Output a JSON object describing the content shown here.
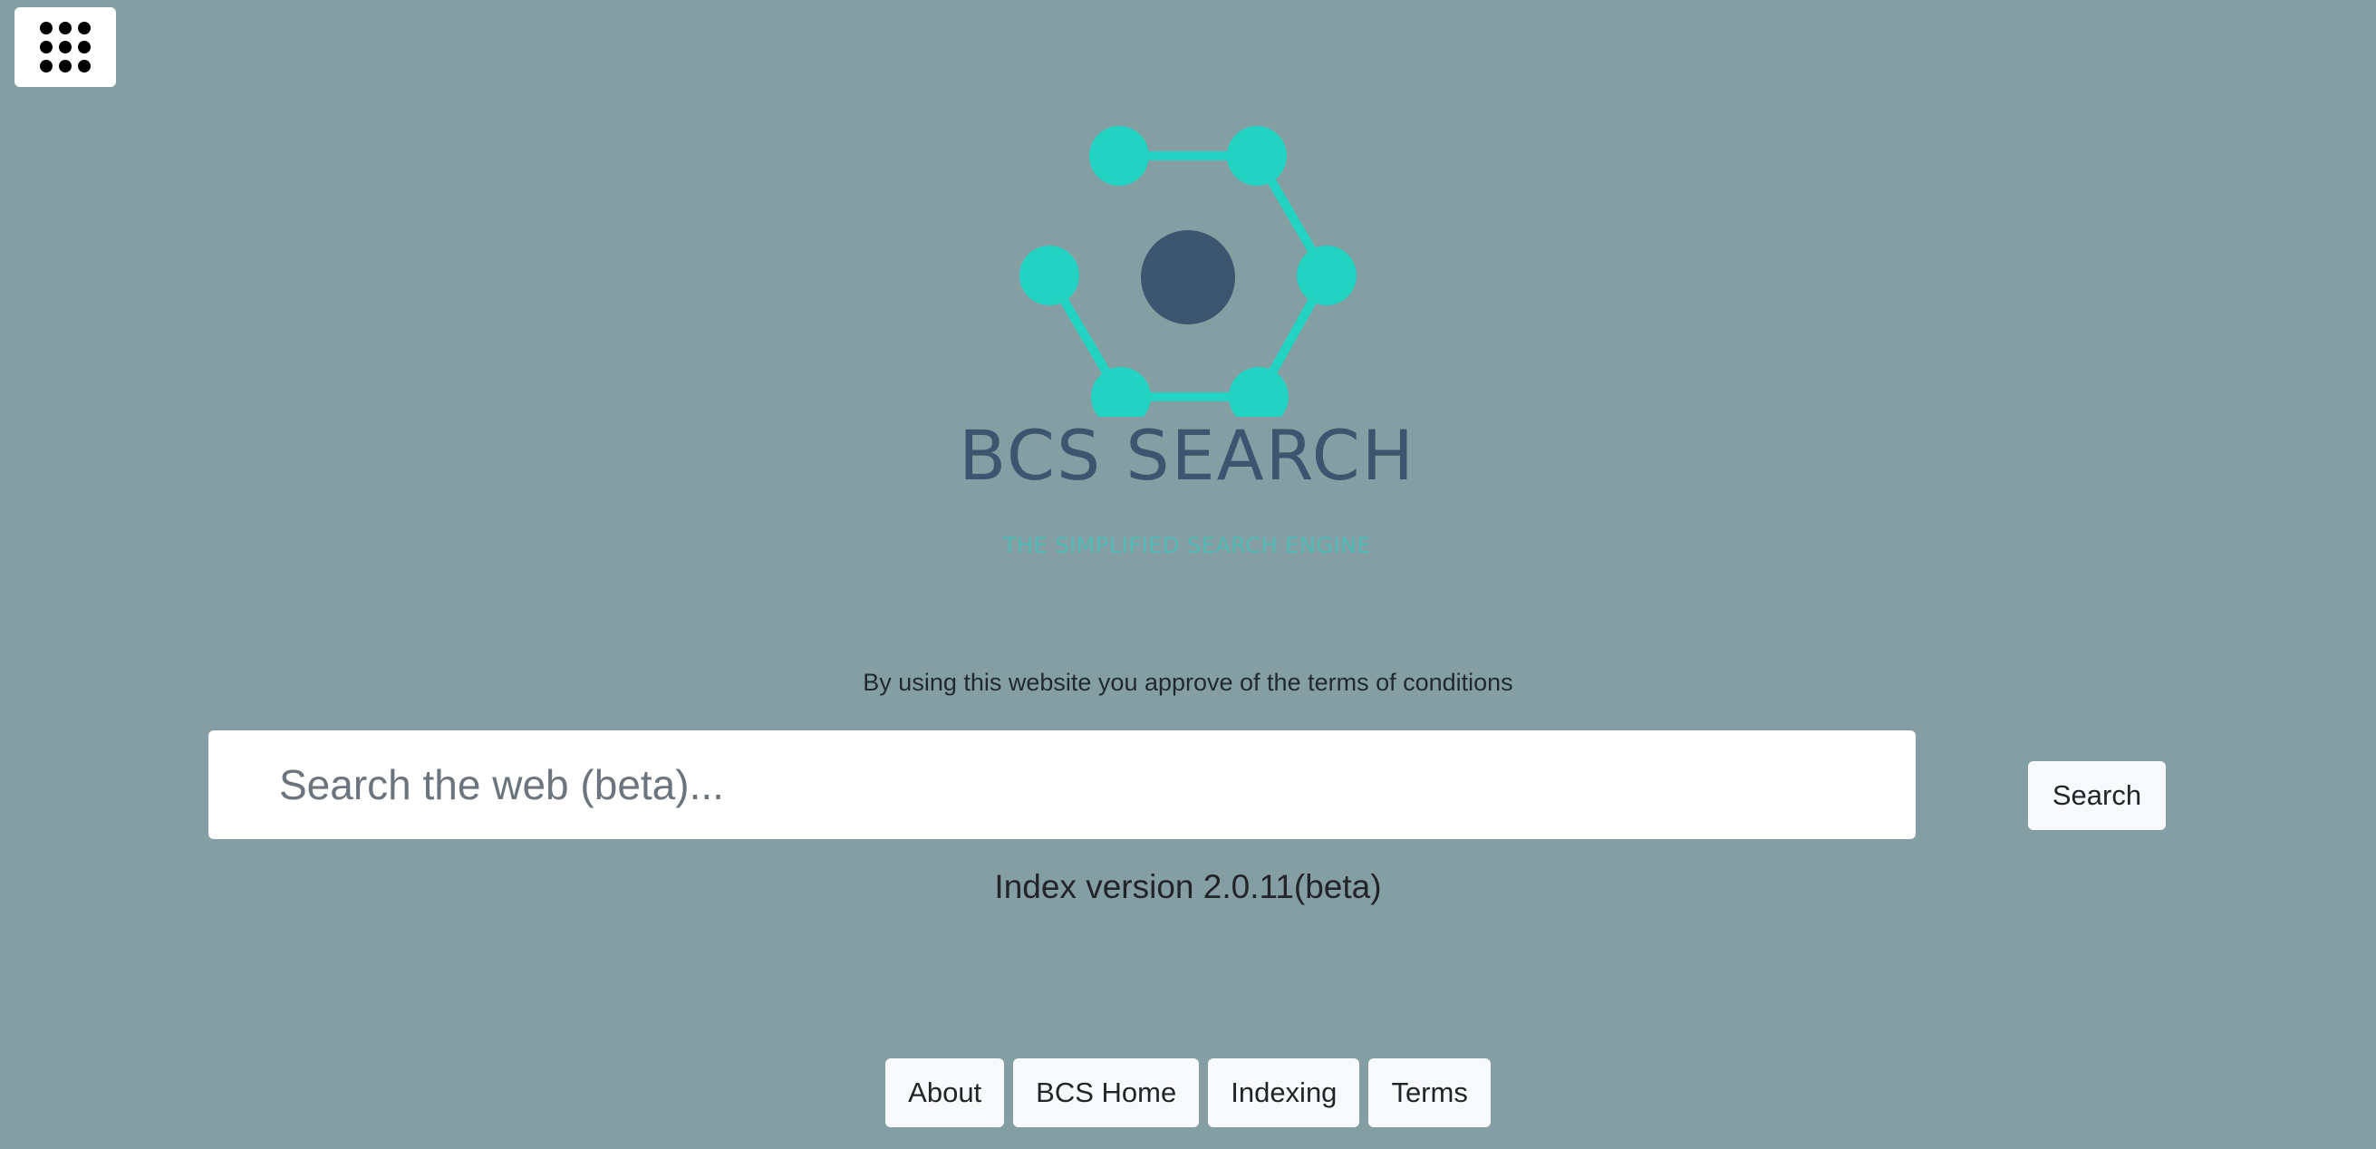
{
  "apps_menu": {
    "icon": "apps-grid-icon"
  },
  "logo": {
    "title": "BCS SEARCH",
    "subtitle": "THE SIMPLIFIED SEARCH ENGINE",
    "icon": "hexagon-network-logo",
    "accent_color": "#22d3c2",
    "center_color": "#3d5670"
  },
  "terms_notice": "By using this website you approve of the terms of conditions",
  "search": {
    "placeholder": "Search the web (beta)...",
    "value": "",
    "button_label": "Search"
  },
  "index_version": "Index version 2.0.11(beta)",
  "footer": {
    "links": [
      {
        "label": "About"
      },
      {
        "label": "BCS Home"
      },
      {
        "label": "Indexing"
      },
      {
        "label": "Terms"
      }
    ]
  },
  "colors": {
    "background": "#859ea3",
    "button_bg": "#f8f9fa"
  }
}
